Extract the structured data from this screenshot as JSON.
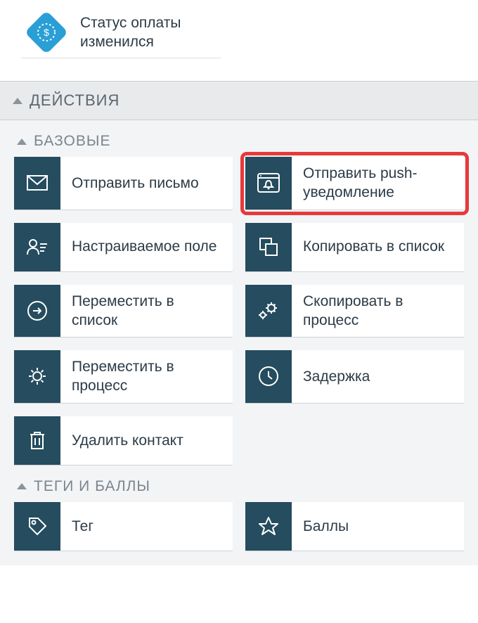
{
  "colors": {
    "icon_bg": "#254c5f",
    "icon_fg": "#ffffff",
    "diamond": "#2a9fd6",
    "highlight": "#e63a3a"
  },
  "top_card": {
    "label": "Статус оплаты изменился"
  },
  "sections": {
    "actions": {
      "title": "ДЕЙСТВИЯ",
      "groups": {
        "basic": {
          "title": "БАЗОВЫЕ",
          "items": [
            {
              "id": "send-email",
              "label": "Отправить письмо"
            },
            {
              "id": "send-push",
              "label": "Отправить push-уведомление",
              "highlighted": true
            },
            {
              "id": "custom-field",
              "label": "Настраиваемое поле"
            },
            {
              "id": "copy-to-list",
              "label": "Копировать в список"
            },
            {
              "id": "move-to-list",
              "label": "Переместить в список"
            },
            {
              "id": "copy-to-process",
              "label": "Скопировать в процесс"
            },
            {
              "id": "move-to-process",
              "label": "Переместить в процесс"
            },
            {
              "id": "delay",
              "label": "Задержка"
            },
            {
              "id": "delete-contact",
              "label": "Удалить контакт"
            }
          ]
        },
        "tags_scores": {
          "title": "ТЕГИ И БАЛЛЫ",
          "items": [
            {
              "id": "tag",
              "label": "Тег"
            },
            {
              "id": "scores",
              "label": "Баллы"
            }
          ]
        }
      }
    }
  }
}
